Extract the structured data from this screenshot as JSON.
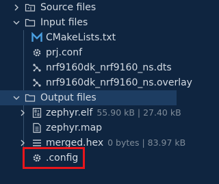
{
  "tree": {
    "source_files": {
      "label": "Source files"
    },
    "input_files": {
      "label": "Input files",
      "items": [
        {
          "label": "CMakeLists.txt"
        },
        {
          "label": "prj.conf"
        },
        {
          "label": "nrf9160dk_nrf9160_ns.dts"
        },
        {
          "label": "nrf9160dk_nrf9160_ns.overlay"
        }
      ]
    },
    "output_files": {
      "label": "Output files",
      "items": [
        {
          "label": "zephyr.elf",
          "desc": "55.90 kB | 27.40 kB"
        },
        {
          "label": "zephyr.map",
          "desc": ""
        },
        {
          "label": "merged.hex",
          "desc": "0 bytes | 83.97 kB"
        },
        {
          "label": ".config",
          "desc": ""
        }
      ]
    }
  },
  "colors": {
    "background": "#0f2540",
    "selected_row": "#1d3d62",
    "text": "#d4dbe3",
    "description": "#7f8c99",
    "highlight_box": "#e8161c",
    "cmake_icon": "#4a9fe0"
  },
  "icons": {
    "folder": "folder-icon",
    "cmake": "cmake-icon",
    "gear": "gear-icon",
    "devicetree": "devicetree-icon",
    "binary": "binary-file-icon",
    "document": "document-icon",
    "list": "list-icon",
    "chevron_down": "chevron-down-icon",
    "chevron_right": "chevron-right-icon"
  }
}
